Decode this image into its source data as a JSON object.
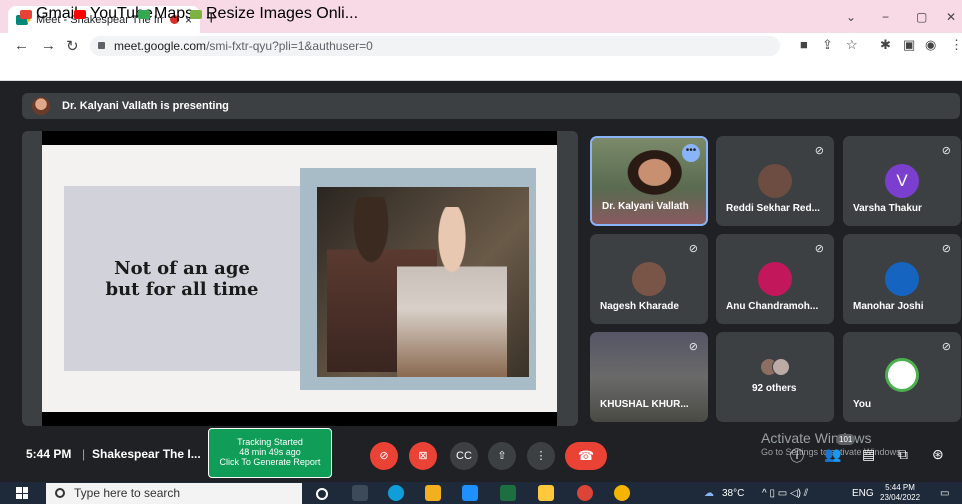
{
  "browser": {
    "tab_title": "Meet - Shakespear The Imm",
    "tab_close": "×",
    "new_tab": "+",
    "url_host": "meet.google.com",
    "url_path": "/smi-fxtr-qyu?pli=1&authuser=0",
    "window_controls": [
      "⌄",
      "−",
      "▢",
      "✕"
    ],
    "bookmarks": [
      {
        "label": "Gmail",
        "color": "#ea4335"
      },
      {
        "label": "YouTube",
        "color": "#ff0000"
      },
      {
        "label": "Maps",
        "color": "#34a853"
      },
      {
        "label": "Resize Images Onli...",
        "color": "#7cb342"
      }
    ]
  },
  "meet": {
    "presenting_text": "Dr. Kalyani Vallath is presenting",
    "slide_quote": "Not of an age\nbut for all time",
    "participants": [
      {
        "name": "Dr. Kalyani Vallath",
        "type": "video-active"
      },
      {
        "name": "Reddi Sekhar Red...",
        "type": "photo",
        "color": "#6d4c41"
      },
      {
        "name": "Varsha Thakur",
        "type": "letter",
        "letter": "V",
        "color": "#7b3fd0"
      },
      {
        "name": "Nagesh Kharade",
        "type": "photo",
        "color": "#795548"
      },
      {
        "name": "Anu Chandramoh...",
        "type": "photo",
        "color": "#c2185b"
      },
      {
        "name": "Manohar Joshi",
        "type": "photo",
        "color": "#1565c0"
      },
      {
        "name": "KHUSHAL KHUR...",
        "type": "video"
      },
      {
        "name": "92 others",
        "type": "others"
      },
      {
        "name": "You",
        "type": "logo"
      }
    ],
    "time": "5:44 PM",
    "separator": "|",
    "meeting_name": "Shakespear The I...",
    "tracker_line1": "Tracking Started",
    "tracker_line2": "48 min 49s ago",
    "tracker_line3": "Click To Generate Report",
    "people_count": "101",
    "watermark_title": "Activate Windows",
    "watermark_sub": "Go to Settings to activate Windows."
  },
  "taskbar": {
    "search_placeholder": "Type here to search",
    "temperature": "38°C",
    "language": "ENG",
    "clock_time": "5:44 PM",
    "clock_date": "23/04/2022"
  }
}
